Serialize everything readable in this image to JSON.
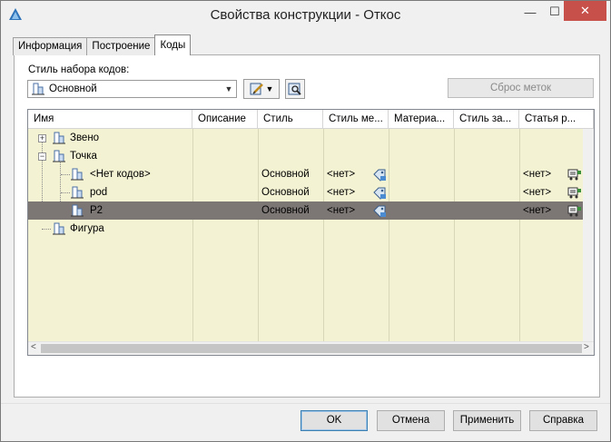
{
  "window": {
    "title": "Свойства конструкции - Откос",
    "minimize_glyph": "—",
    "maximize_glyph": "☐",
    "close_glyph": "✕"
  },
  "tabs": [
    {
      "label": "Информация",
      "active": false
    },
    {
      "label": "Построение",
      "active": false
    },
    {
      "label": "Коды",
      "active": true
    }
  ],
  "codes": {
    "style_label": "Стиль набора кодов:",
    "style_value": "Основной",
    "reset_button": "Сброс меток"
  },
  "grid": {
    "columns": [
      "Имя",
      "Описание",
      "Стиль",
      "Стиль ме...",
      "Материа...",
      "Стиль за...",
      "Статья р..."
    ],
    "rows": [
      {
        "name": "Звено",
        "level": 0,
        "expander": "+",
        "description": "",
        "style": "",
        "style_label": "",
        "material": "",
        "shade_style": "",
        "pay_item": "",
        "selected": false
      },
      {
        "name": "Точка",
        "level": 0,
        "expander": "−",
        "description": "",
        "style": "",
        "style_label": "",
        "material": "",
        "shade_style": "",
        "pay_item": "",
        "selected": false
      },
      {
        "name": "<Нет кодов>",
        "level": 1,
        "expander": "",
        "description": "",
        "style": "Основной",
        "style_label": "<нет>",
        "material": "",
        "shade_style": "",
        "pay_item": "<нет>",
        "selected": false
      },
      {
        "name": "pod",
        "level": 1,
        "expander": "",
        "description": "",
        "style": "Основной",
        "style_label": "<нет>",
        "material": "",
        "shade_style": "",
        "pay_item": "<нет>",
        "selected": false
      },
      {
        "name": "P2",
        "level": 1,
        "expander": "",
        "description": "",
        "style": "Основной",
        "style_label": "<нет>",
        "material": "",
        "shade_style": "",
        "pay_item": "<нет>",
        "selected": true
      },
      {
        "name": "Фигура",
        "level": 0,
        "expander": "",
        "description": "",
        "style": "",
        "style_label": "",
        "material": "",
        "shade_style": "",
        "pay_item": "",
        "selected": false
      }
    ],
    "scroll_left": "<",
    "scroll_right": ">"
  },
  "buttons": {
    "ok": "OK",
    "cancel": "Отмена",
    "apply": "Применить",
    "help": "Справка"
  },
  "colors": {
    "grid_background": "#f3f2d2",
    "selected_row": "#7c7775",
    "close_button": "#c7504b"
  }
}
